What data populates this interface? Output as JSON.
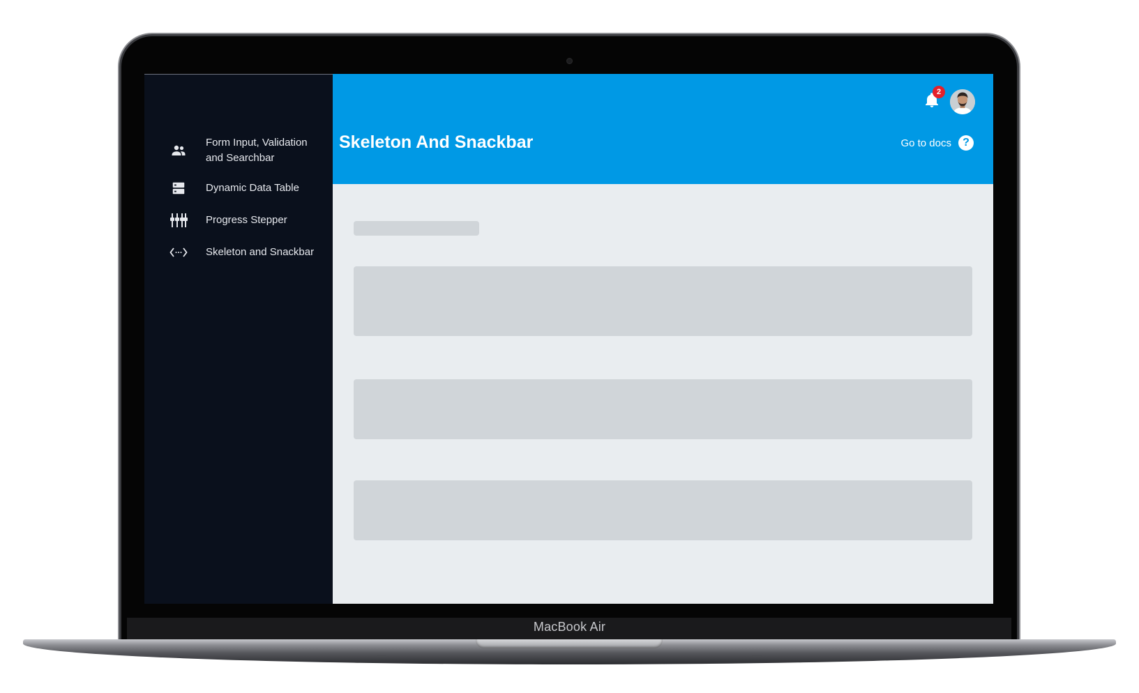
{
  "device": {
    "label": "MacBook Air"
  },
  "sidebar": {
    "items": [
      {
        "label": "Form Input, Validation and Searchbar",
        "icon": "people-icon"
      },
      {
        "label": "Dynamic Data Table",
        "icon": "storage-icon"
      },
      {
        "label": "Progress Stepper",
        "icon": "stepper-icon"
      },
      {
        "label": "Skeleton and Snackbar",
        "icon": "code-icon"
      }
    ]
  },
  "header": {
    "title": "Skeleton And Snackbar",
    "docs_label": "Go to docs",
    "docs_icon": "help-circle-icon",
    "notification_count": "2",
    "notification_icon": "bell-icon",
    "avatar_icon": "user-avatar"
  },
  "colors": {
    "sidebar_bg": "#0a101c",
    "header_bg": "#0099e5",
    "content_bg": "#e9edf0",
    "skeleton": "#d0d5d9",
    "badge": "#e4202b"
  }
}
